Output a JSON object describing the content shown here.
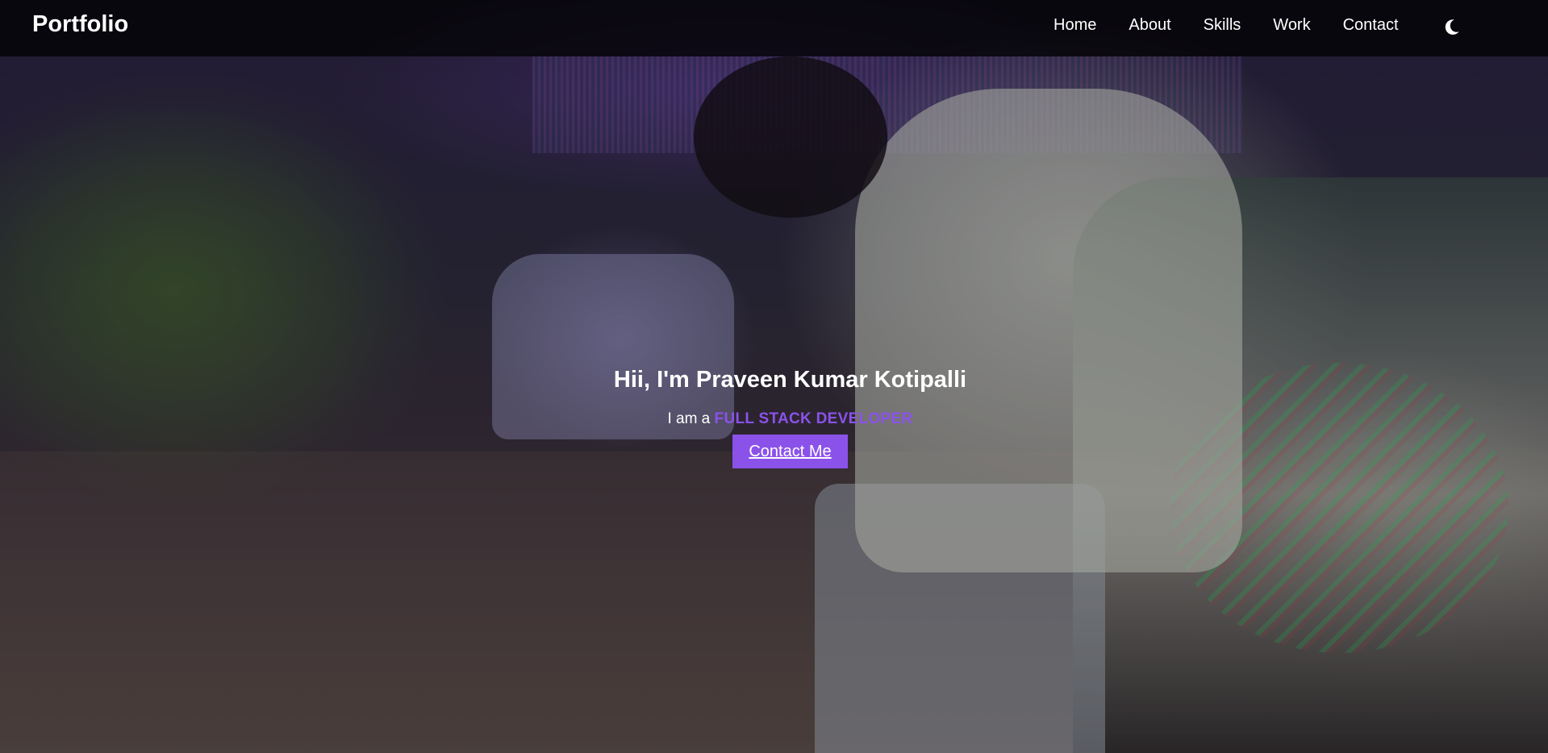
{
  "navbar": {
    "brand": "Portfolio",
    "links": [
      "Home",
      "About",
      "Skills",
      "Work",
      "Contact"
    ],
    "theme_toggle_icon": "moon-icon"
  },
  "hero": {
    "greeting": "Hii, I'm Praveen Kumar Kotipalli",
    "subtitle_prefix": "I am a",
    "role": "FULL STACK DEVELOPER",
    "cta_label": "Contact Me",
    "background_image": "photo of a person in a white shirt beside parked cars at night with purple/green light effects"
  },
  "colors": {
    "accent": "#8b52ea",
    "nav_background": "#000000",
    "text": "#ffffff"
  }
}
